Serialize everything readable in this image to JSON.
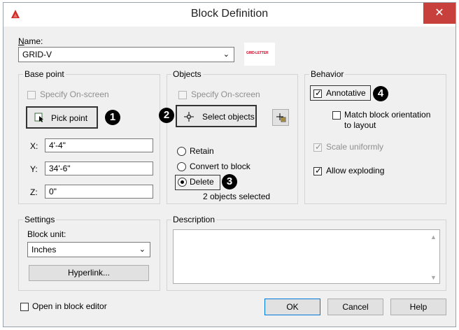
{
  "window": {
    "title": "Block Definition",
    "close_glyph": "✕"
  },
  "name": {
    "label": "Name:",
    "value": "GRID-V",
    "preview_text": "GRID-LETTER"
  },
  "base_point": {
    "title": "Base point",
    "specify_onscreen": "Specify On-screen",
    "pick_point": "Pick point",
    "x_label": "X:",
    "x_value": "4'-4\"",
    "y_label": "Y:",
    "y_value": "34'-6\"",
    "z_label": "Z:",
    "z_value": "0\""
  },
  "objects": {
    "title": "Objects",
    "specify_onscreen": "Specify On-screen",
    "select_objects": "Select objects",
    "retain": "Retain",
    "convert": "Convert to block",
    "delete": "Delete",
    "status": "2 objects selected"
  },
  "behavior": {
    "title": "Behavior",
    "annotative": "Annotative",
    "match_orientation_1": "Match block orientation",
    "match_orientation_2": "to layout",
    "scale_uniformly": "Scale uniformly",
    "allow_exploding": "Allow exploding"
  },
  "settings": {
    "title": "Settings",
    "block_unit_label": "Block unit:",
    "block_unit_value": "Inches",
    "hyperlink": "Hyperlink..."
  },
  "description": {
    "title": "Description",
    "value": ""
  },
  "footer": {
    "open_in_editor": "Open in block editor",
    "ok": "OK",
    "cancel": "Cancel",
    "help": "Help"
  },
  "callouts": [
    "1",
    "2",
    "3",
    "4"
  ],
  "colors": {
    "accent_red": "#c8403b",
    "callout": "#000000"
  }
}
